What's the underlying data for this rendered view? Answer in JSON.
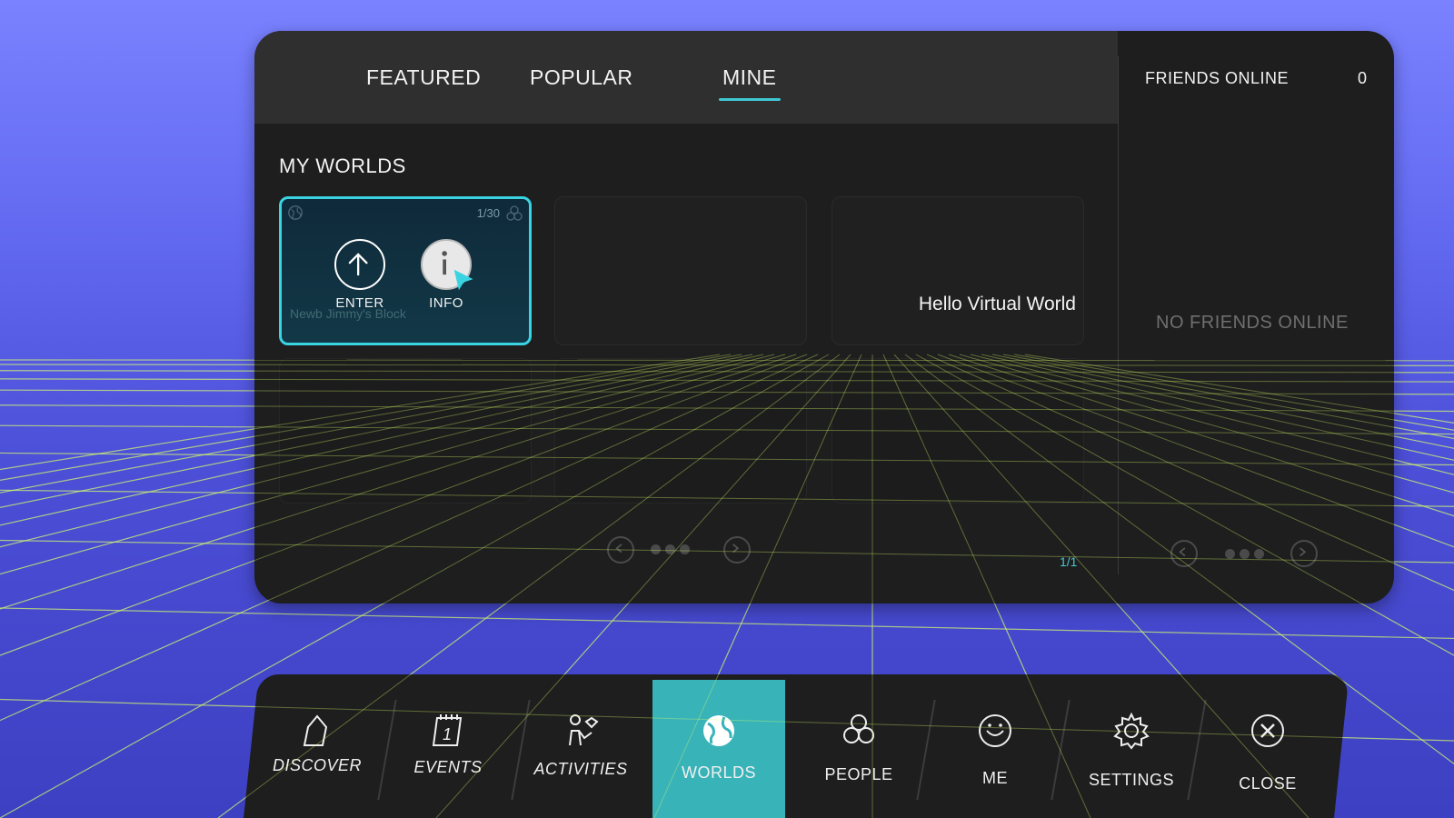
{
  "tabs": [
    {
      "label": "FEATURED",
      "active": false
    },
    {
      "label": "POPULAR",
      "active": false
    },
    {
      "label": "MINE",
      "active": true
    }
  ],
  "section_title": "MY WORLDS",
  "worlds": [
    {
      "name": "Newb Jimmy's Block",
      "occupancy": "1/30",
      "selected": true,
      "actions": [
        {
          "label": "ENTER",
          "icon": "arrow-up-icon"
        },
        {
          "label": "INFO",
          "icon": "info-icon"
        }
      ]
    },
    {
      "name": "",
      "selected": false
    },
    {
      "name": "Hello Virtual World",
      "selected": false
    }
  ],
  "pagination": {
    "indicator": "1/1"
  },
  "friends": {
    "title": "FRIENDS ONLINE",
    "count": "0",
    "empty_message": "NO FRIENDS ONLINE"
  },
  "nav": [
    {
      "label": "DISCOVER",
      "icon": "home-icon",
      "active": false
    },
    {
      "label": "EVENTS",
      "icon": "calendar-icon",
      "active": false
    },
    {
      "label": "ACTIVITIES",
      "icon": "activities-icon",
      "active": false
    },
    {
      "label": "WORLDS",
      "icon": "globe-icon",
      "active": true
    },
    {
      "label": "PEOPLE",
      "icon": "people-icon",
      "active": false
    },
    {
      "label": "ME",
      "icon": "smiley-icon",
      "active": false
    },
    {
      "label": "SETTINGS",
      "icon": "gear-icon",
      "active": false
    },
    {
      "label": "CLOSE",
      "icon": "close-icon",
      "active": false
    }
  ],
  "colors": {
    "accent": "#3ad3e2",
    "nav_active": "#38b3b8",
    "panel": "#1e1e1e",
    "grid": "#d8ff6a",
    "sky": "#6168f0"
  }
}
